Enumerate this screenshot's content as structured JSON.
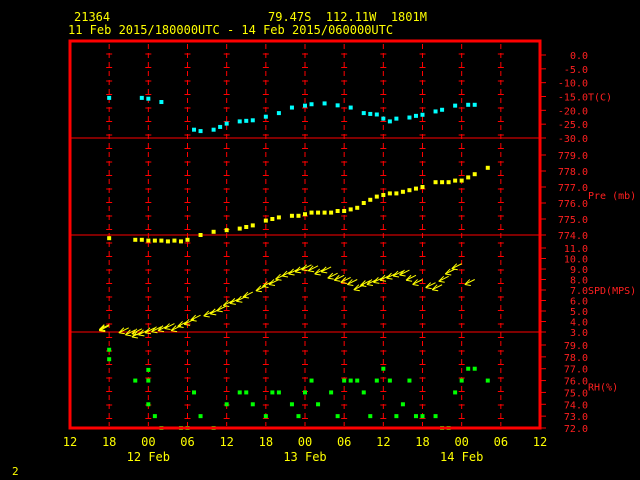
{
  "header": {
    "station": "21364",
    "location": "79.47S  112.11W  1801M",
    "period": "11 Feb 2015/180000UTC - 14 Feb 2015/060000UTC"
  },
  "footer": {
    "page_number": "2"
  },
  "colors": {
    "background": "#000000",
    "frame": "#ff0000",
    "gridline": "#ff0000",
    "text": "#ffff00",
    "temperature": "#00ffff",
    "pressure": "#ffff00",
    "wind": "#ffff00",
    "rh": "#00ff00",
    "axis_label": "#ff2020"
  },
  "chart_data": {
    "type": "scatter",
    "x_unit": "hours since 11 Feb 2015 12 UTC",
    "x_range": [
      0,
      66
    ],
    "x_ticks": [
      {
        "h": 0,
        "label": "12"
      },
      {
        "h": 6,
        "label": "18"
      },
      {
        "h": 12,
        "label": "00"
      },
      {
        "h": 18,
        "label": "06"
      },
      {
        "h": 24,
        "label": "12"
      },
      {
        "h": 30,
        "label": "18"
      },
      {
        "h": 36,
        "label": "00"
      },
      {
        "h": 42,
        "label": "06"
      },
      {
        "h": 48,
        "label": "12"
      },
      {
        "h": 54,
        "label": "18"
      },
      {
        "h": 60,
        "label": "00"
      },
      {
        "h": 66,
        "label": "06"
      },
      {
        "h": 72,
        "label": "12"
      }
    ],
    "date_labels": [
      {
        "h": 12,
        "label": "12 Feb"
      },
      {
        "h": 36,
        "label": "13 Feb"
      },
      {
        "h": 60,
        "label": "14 Feb"
      }
    ],
    "panels": [
      {
        "name": "temperature",
        "axis_label": "T(C)",
        "ylim": [
          -30,
          0
        ],
        "step": 5,
        "ticks": [
          "0.0",
          "-5.0",
          "-10.0",
          "-15.0",
          "-20.0",
          "-25.0",
          "-30.0"
        ],
        "x": [
          6,
          11,
          12,
          14,
          19,
          20,
          22,
          23,
          24,
          26,
          27,
          28,
          30,
          32,
          34,
          36,
          37,
          39,
          41,
          43,
          45,
          46,
          47,
          48,
          49,
          50,
          52,
          53,
          54,
          56,
          57,
          59,
          61,
          62
        ],
        "values": [
          -15.5,
          -15.5,
          -15.8,
          -17,
          -27,
          -27.5,
          -27,
          -26,
          -24.8,
          -24,
          -23.8,
          -23.6,
          -22.3,
          -21,
          -19,
          -18.3,
          -17.8,
          -17.5,
          -18.2,
          -19,
          -21,
          -21.3,
          -21.5,
          -23,
          -24,
          -23,
          -22.6,
          -22,
          -21.6,
          -20.4,
          -19.8,
          -18.3,
          -18,
          -18
        ]
      },
      {
        "name": "pressure",
        "axis_label": "Pre (mb)",
        "ylim": [
          773.0,
          779.0
        ],
        "step": 1,
        "ticks": [
          "779.0",
          "778.0",
          "777.0",
          "776.0",
          "775.0",
          "774.0"
        ],
        "x": [
          6,
          10,
          11,
          12,
          13,
          14,
          15,
          16,
          17,
          18,
          20,
          22,
          24,
          26,
          27,
          28,
          30,
          31,
          32,
          34,
          35,
          36,
          37,
          38,
          39,
          40,
          41,
          42,
          43,
          44,
          45,
          46,
          47,
          48,
          49,
          50,
          51,
          52,
          53,
          54,
          56,
          57,
          58,
          59,
          60,
          61,
          62,
          64
        ],
        "values": [
          773.8,
          773.7,
          773.7,
          773.65,
          773.65,
          773.65,
          773.6,
          773.65,
          773.6,
          773.7,
          774.0,
          774.2,
          774.3,
          774.4,
          774.5,
          774.6,
          774.9,
          775.0,
          775.1,
          775.2,
          775.2,
          775.3,
          775.4,
          775.4,
          775.4,
          775.4,
          775.5,
          775.5,
          775.6,
          775.7,
          776.0,
          776.2,
          776.4,
          776.5,
          776.6,
          776.6,
          776.7,
          776.8,
          776.9,
          777.0,
          777.3,
          777.3,
          777.3,
          777.4,
          777.4,
          777.6,
          777.8,
          778.2
        ]
      },
      {
        "name": "wind_speed",
        "axis_label": "SPD(MPS)",
        "ylim": [
          2.0,
          11.0
        ],
        "step": 1,
        "ticks": [
          "11.0",
          "10.0",
          "9.0",
          "8.0",
          "7.0",
          "6.0",
          "5.0",
          "4.0",
          "3.0"
        ],
        "x": [
          6,
          6,
          9,
          10,
          11,
          11,
          12,
          13,
          14,
          15,
          16,
          17,
          18,
          19,
          20,
          22,
          23,
          24,
          25,
          26,
          27,
          28,
          30,
          31,
          32,
          33,
          34,
          35,
          36,
          37,
          38,
          39,
          40,
          41,
          42,
          43,
          44,
          45,
          46,
          47,
          48,
          49,
          50,
          51,
          52,
          53,
          54,
          56,
          57,
          58,
          59,
          60,
          62
        ],
        "values": [
          3.6,
          3.7,
          3.4,
          3.2,
          3.0,
          3.3,
          3.2,
          3.4,
          3.5,
          3.6,
          3.8,
          3.6,
          4.0,
          4.2,
          4.6,
          5.0,
          5.2,
          5.5,
          6.0,
          6.2,
          6.4,
          6.8,
          7.4,
          7.8,
          8.0,
          8.5,
          8.8,
          9.0,
          9.2,
          9.4,
          9.3,
          9.0,
          9.2,
          8.6,
          8.4,
          8.2,
          8.0,
          7.5,
          7.9,
          8.0,
          8.2,
          8.4,
          8.6,
          8.8,
          8.9,
          8.4,
          8.0,
          7.7,
          7.5,
          8.3,
          9.0,
          9.5,
          8.0
        ],
        "arrow_from_deg": 315
      },
      {
        "name": "rh",
        "axis_label": "RH(%)",
        "ylim": [
          72.0,
          79.0
        ],
        "step": 1,
        "ticks": [
          "79.0",
          "78.0",
          "77.0",
          "76.0",
          "75.0",
          "74.0",
          "73.0",
          "72.0"
        ],
        "x": [
          6,
          6,
          10,
          12,
          12,
          12,
          13,
          14,
          17,
          18,
          19,
          20,
          22,
          24,
          26,
          27,
          28,
          30,
          31,
          32,
          34,
          35,
          36,
          37,
          38,
          40,
          41,
          42,
          43,
          44,
          45,
          46,
          47,
          48,
          49,
          50,
          51,
          52,
          53,
          54,
          56,
          57,
          58,
          59,
          60,
          61,
          62,
          64
        ],
        "values": [
          78.6,
          77.8,
          76.0,
          76.9,
          76.0,
          74.0,
          73.0,
          72.0,
          72.0,
          72.0,
          75.0,
          73.0,
          72.0,
          74.0,
          75.0,
          75.0,
          74.0,
          73.0,
          75.0,
          75.0,
          74.0,
          73.0,
          75.0,
          76.0,
          74.0,
          75.0,
          73.0,
          76.0,
          76.0,
          76.0,
          75.0,
          73.0,
          76.0,
          77.0,
          76.0,
          73.0,
          74.0,
          76.0,
          73.0,
          73.0,
          73.0,
          72.0,
          72.0,
          75.0,
          76.0,
          77.0,
          77.0,
          76.0
        ]
      }
    ]
  }
}
